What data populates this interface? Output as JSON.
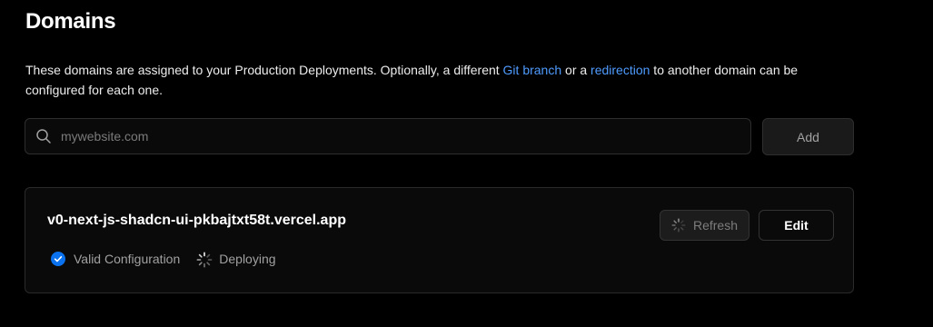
{
  "page": {
    "title": "Domains"
  },
  "description": {
    "text_before": "These domains are assigned to your Production Deployments. Optionally, a different ",
    "link_git_branch": "Git branch",
    "text_middle": " or a ",
    "link_redirection": "redirection",
    "text_after": " to another domain can be configured for each one."
  },
  "search": {
    "placeholder": "mywebsite.com",
    "value": "",
    "icon": "search-icon"
  },
  "add_button": {
    "label": "Add"
  },
  "domain_card": {
    "domain": "v0-next-js-shadcn-ui-pkbajtxt58t.vercel.app",
    "status_valid": "Valid Configuration",
    "status_deploying": "Deploying",
    "refresh_label": "Refresh",
    "edit_label": "Edit",
    "valid_color": "#0a72ef"
  },
  "colors": {
    "background": "#000000",
    "link": "#4f9bff",
    "valid_check": "#0a72ef"
  }
}
